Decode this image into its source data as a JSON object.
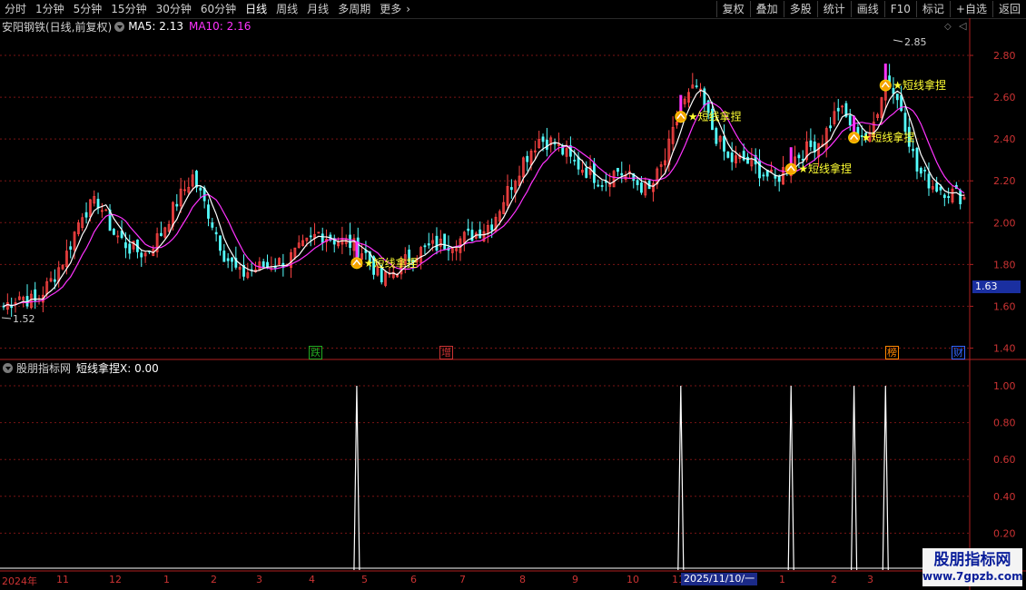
{
  "toolbar": {
    "periods": [
      "分时",
      "1分钟",
      "5分钟",
      "15分钟",
      "30分钟",
      "60分钟",
      "日线",
      "周线",
      "月线",
      "多周期",
      "更多"
    ],
    "active_period": "日线",
    "right_buttons": [
      "复权",
      "叠加",
      "多股",
      "统计",
      "画线",
      "F10",
      "标记",
      "+自选",
      "返回"
    ]
  },
  "main_info": {
    "title": "安阳钢铁(日线,前复权)",
    "ma5": "MA5: 2.13",
    "ma10": "MA10: 2.16",
    "colors": {
      "ma5": "#ffffff",
      "ma10": "#ff33ff"
    }
  },
  "sub_info": {
    "title": "股朋指标网",
    "indicator": "短线拿捏X: 0.00"
  },
  "price_axis": [
    "2.80",
    "2.60",
    "2.40",
    "2.20",
    "2.00",
    "1.80",
    "1.60",
    "1.40"
  ],
  "sub_axis": [
    "1.00",
    "0.80",
    "0.60",
    "0.40",
    "0.20"
  ],
  "current_price": "1.63",
  "annotations": {
    "high": "2.85",
    "low": "1.52",
    "signal_text": "短线拿捏"
  },
  "event_tags": [
    "跌",
    "增",
    "榜",
    "财"
  ],
  "date_axis": [
    "2024年",
    "11",
    "12",
    "1",
    "2",
    "3",
    "4",
    "5",
    "6",
    "7",
    "8",
    "9",
    "10",
    "11",
    "2025/11/10/一",
    "1",
    "2",
    "3"
  ],
  "watermark": {
    "line1": "股朋指标网",
    "line2": "www.7gpzb.com"
  },
  "chart_data": {
    "type": "candlestick",
    "ylim": [
      1.35,
      2.9
    ],
    "close_series_approx": [
      1.6,
      1.65,
      1.62,
      1.72,
      1.85,
      2.05,
      2.1,
      1.95,
      1.88,
      1.85,
      1.95,
      2.1,
      2.22,
      2.05,
      1.85,
      1.75,
      1.78,
      1.8,
      1.82,
      1.88,
      1.95,
      1.92,
      1.9,
      1.85,
      1.72,
      1.78,
      1.85,
      1.88,
      1.9,
      1.92,
      1.95,
      2.0,
      2.15,
      2.3,
      2.4,
      2.38,
      2.3,
      2.25,
      2.2,
      2.25,
      2.2,
      2.15,
      2.3,
      2.55,
      2.65,
      2.45,
      2.3,
      2.3,
      2.25,
      2.2,
      2.3,
      2.35,
      2.4,
      2.55,
      2.45,
      2.4,
      2.7,
      2.55,
      2.25,
      2.18,
      2.15,
      2.12
    ],
    "signals_x_index": [
      23,
      43,
      50,
      54,
      56
    ],
    "signal_values": [
      1,
      1,
      1,
      1,
      1
    ]
  }
}
